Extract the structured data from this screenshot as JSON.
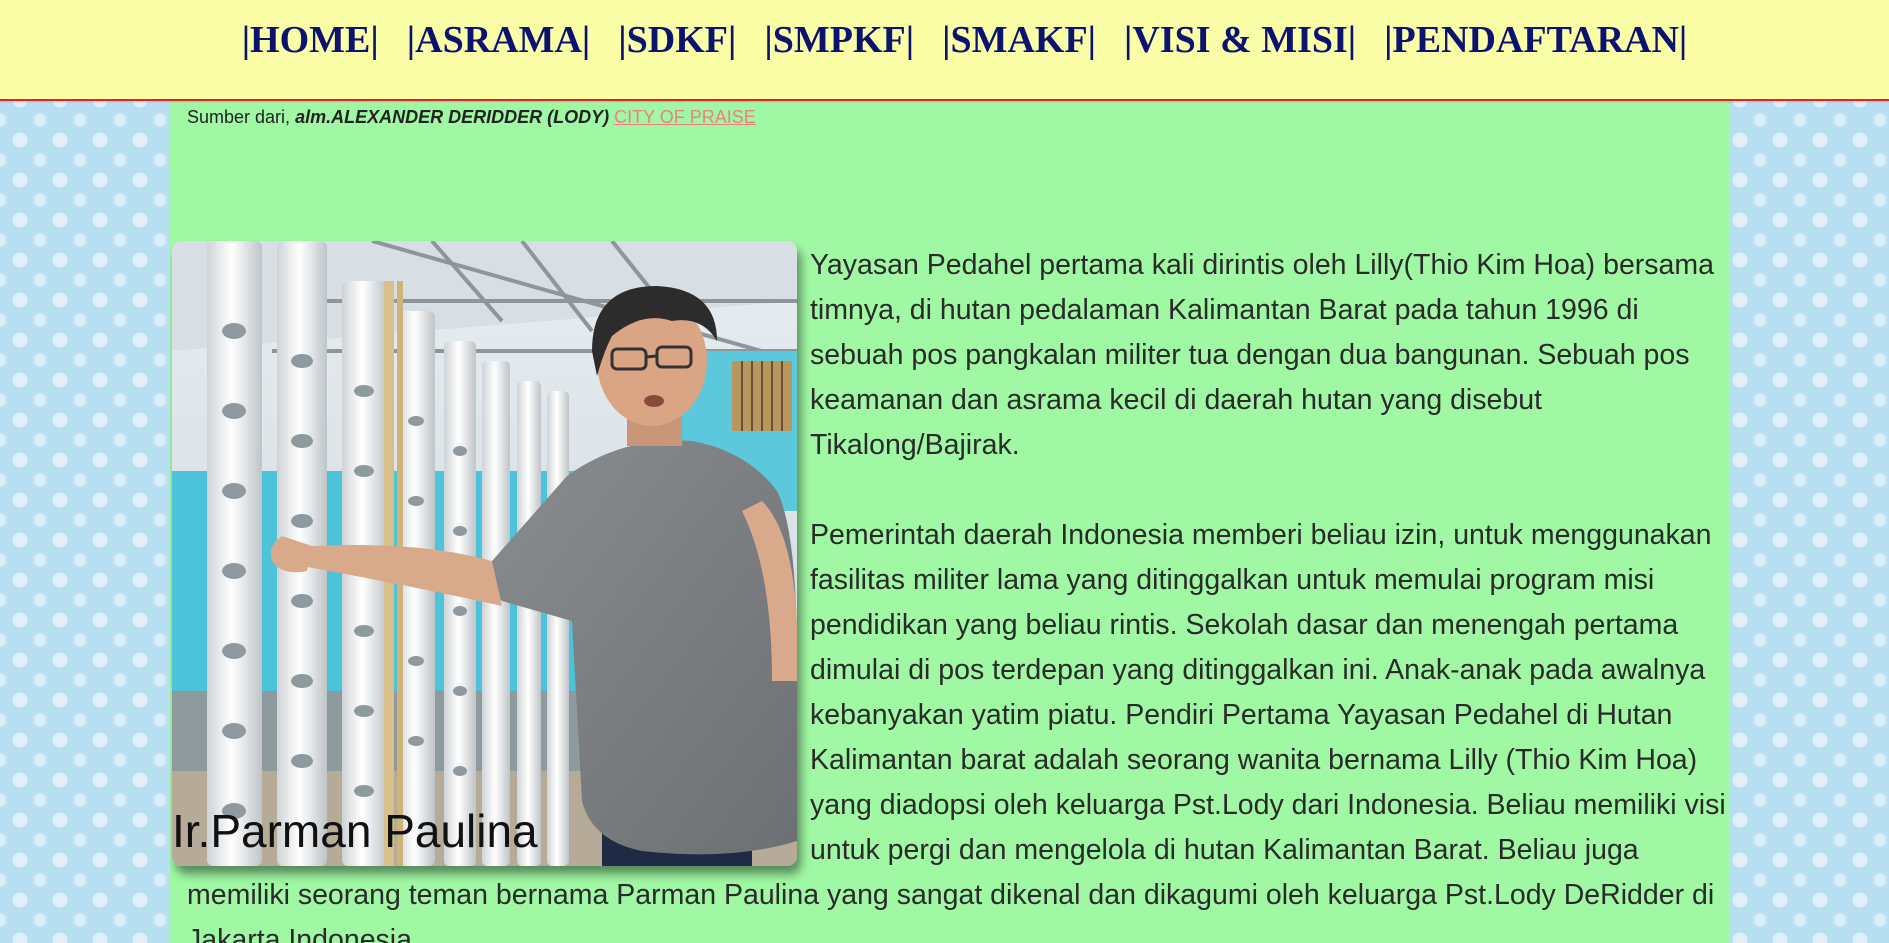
{
  "nav": {
    "items": [
      {
        "label": "|HOME|"
      },
      {
        "label": "|ASRAMA|"
      },
      {
        "label": "|SDKF|"
      },
      {
        "label": "|SMPKF|"
      },
      {
        "label": "|SMAKF|"
      },
      {
        "label": "|VISI & MISI|"
      },
      {
        "label": "|PENDAFTARAN|"
      }
    ]
  },
  "source": {
    "prefix": "Sumber dari,",
    "author": "alm.ALEXANDER DERIDDER (LODY)",
    "link_text": "CITY OF PRAISE"
  },
  "photo": {
    "caption": "Ir.Parman Paulina"
  },
  "article": {
    "paragraph1": "Yayasan Pedahel pertama kali dirintis oleh Lilly(Thio Kim Hoa) bersama timnya, di hutan pedalaman Kalimantan Barat pada tahun 1996 di sebuah pos pangkalan militer tua dengan dua bangunan. Sebuah pos keamanan dan asrama kecil di daerah hutan yang disebut Tikalong/Bajirak.",
    "paragraph2": "Pemerintah daerah Indonesia memberi beliau izin, untuk menggunakan fasilitas militer lama yang ditinggalkan untuk memulai program misi pendidikan yang beliau rintis. Sekolah dasar dan menengah pertama dimulai di pos terdepan yang ditinggalkan ini. Anak-anak pada awalnya kebanyakan yatim piatu. Pendiri Pertama Yayasan Pedahel di Hutan Kalimantan barat adalah seorang wanita bernama Lilly (Thio Kim Hoa) yang diadopsi oleh keluarga Pst.Lody dari Indonesia. Beliau memiliki visi untuk pergi dan mengelola di hutan Kalimantan Barat. Beliau juga memiliki seorang teman bernama Parman Paulina yang sangat dikenal dan dikagumi oleh keluarga Pst.Lody DeRidder di Jakarta Indonesia."
  },
  "colors": {
    "nav_bg": "#fafea6",
    "nav_text": "#0b1270",
    "nav_border": "#d9262c",
    "content_bg": "#a0f8a4",
    "link": "#f08080",
    "page_bg": "#b8def2"
  }
}
